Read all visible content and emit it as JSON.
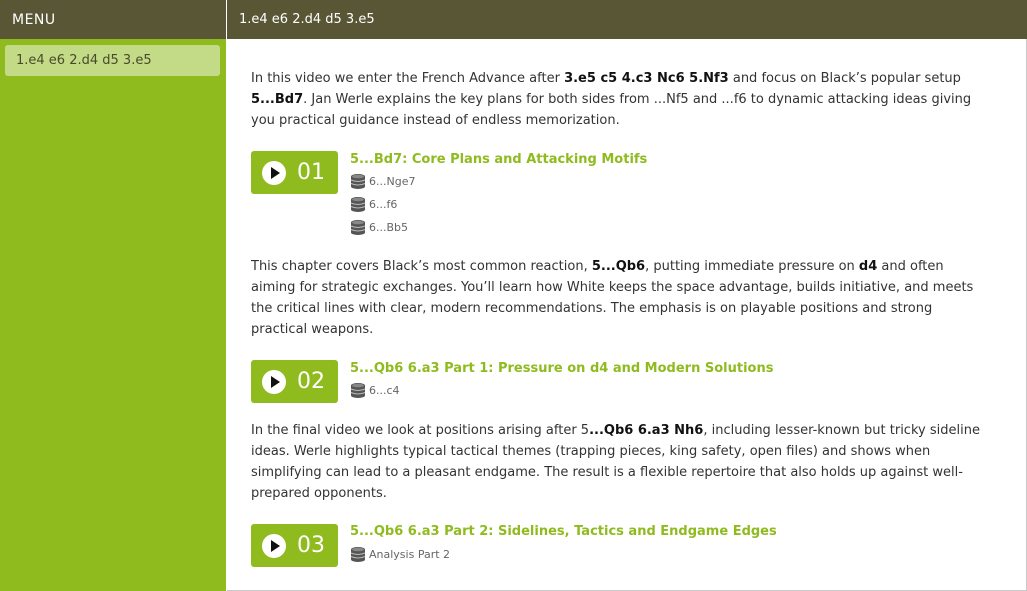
{
  "sidebar": {
    "header": "MENU",
    "items": [
      {
        "label": "1.e4 e6 2.d4 d5 3.e5"
      }
    ]
  },
  "topbar": {
    "title": "1.e4 e6 2.d4 d5 3.e5"
  },
  "intro": {
    "p1": " In this video we enter the French Advance after ",
    "b1": "3.e5 c5 4.c3 Nc6 5.Nf3",
    "p2": " and focus on Black’s popular setup ",
    "b2": "5...Bd7",
    "p3": ". Jan Werle explains the key plans for both sides from ...Nf5 and ...f6 to dynamic attacking ideas giving you practical guidance instead of endless memorization."
  },
  "chapters": [
    {
      "number": "01",
      "title": "5...Bd7: Core Plans and Attacking Motifs",
      "games": [
        "6...Nge7",
        "6...f6",
        "6...Bb5"
      ]
    },
    {
      "number": "02",
      "title": "5...Qb6 6.a3 Part 1: Pressure on d4 and Modern Solutions",
      "games": [
        "6...c4"
      ]
    },
    {
      "number": "03",
      "title": "5...Qb6 6.a3 Part 2: Sidelines, Tactics and Endgame Edges",
      "games": [
        "Analysis Part 2"
      ]
    }
  ],
  "para2": {
    "p1": "This chapter covers Black’s most common reaction, ",
    "b1": "5...Qb6",
    "p2": ", putting immediate pressure on ",
    "b2": "d4",
    "p3": " and often aiming for strategic exchanges. You’ll learn how White keeps the space advantage, builds initiative, and meets the critical lines with clear, modern recommendations. The emphasis is on playable positions and strong practical weapons."
  },
  "para3": {
    "p1": "In the final video we look at positions arising after 5",
    "b1": "...Qb6 6.a3 Nh6",
    "p2": ", including lesser-known but tricky sideline ideas. Werle highlights typical tactical themes (trapping pieces, king safety, open files) and shows when simplifying can lead to a pleasant endgame. The result is a flexible repertoire that also holds up against well-prepared opponents."
  },
  "icons": {
    "play": "play-icon",
    "database": "database-icon"
  },
  "colors": {
    "accent": "#8fbb1f",
    "header": "#585634",
    "menu_item": "#c3db87"
  }
}
